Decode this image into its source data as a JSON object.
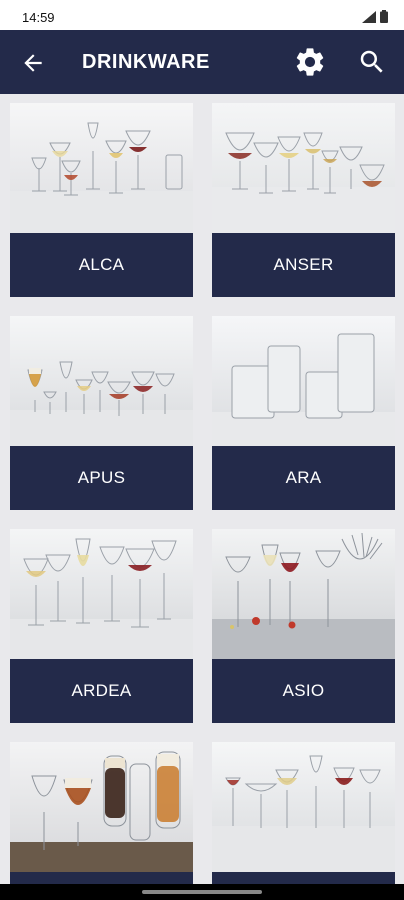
{
  "status_bar": {
    "time": "14:59"
  },
  "app_bar": {
    "title": "DRINKWARE"
  },
  "icons": {
    "back": "arrow-left-icon",
    "settings": "gear-icon",
    "search": "search-icon"
  },
  "colors": {
    "navy": "#232a4a",
    "background": "#e9e9ec"
  },
  "products": [
    {
      "name": "ALCA"
    },
    {
      "name": "ANSER"
    },
    {
      "name": "APUS"
    },
    {
      "name": "ARA"
    },
    {
      "name": "ARDEA"
    },
    {
      "name": "ASIO"
    },
    {
      "name": ""
    },
    {
      "name": ""
    }
  ]
}
